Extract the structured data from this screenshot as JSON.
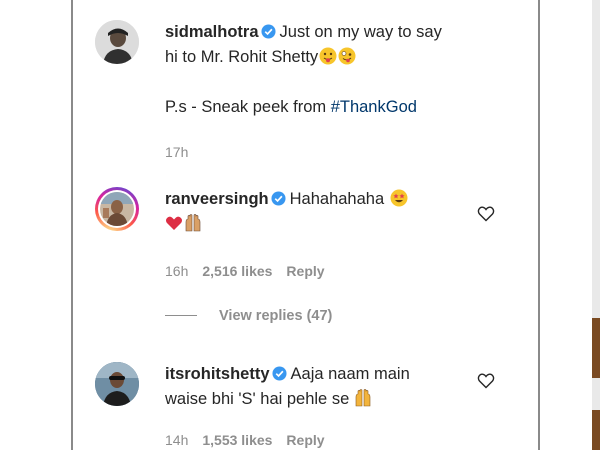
{
  "comments": [
    {
      "username": "sidmalhotra",
      "text_line1": "Just on my way to say",
      "text_line2": "hi to Mr. Rohit Shetty",
      "ps_prefix": "P.s - Sneak peek from ",
      "hashtag": "#ThankGod",
      "time": "17h",
      "avatar": "sidmalhotra-avatar"
    },
    {
      "username": "ranveersingh",
      "text": "Hahahahaha",
      "time": "16h",
      "likes": "2,516 likes",
      "reply_label": "Reply",
      "avatar": "ranveersingh-avatar"
    },
    {
      "username": "itsrohitshetty",
      "text_line1": "Aaja naam main",
      "text_line2": "waise bhi 'S' hai pehle se",
      "time": "14h",
      "likes": "1,553 likes",
      "reply_label": "Reply",
      "avatar": "itsrohitshetty-avatar"
    }
  ],
  "view_replies": "View replies (47)",
  "colors": {
    "text": "#262626",
    "muted": "#8e8e8e",
    "hashtag": "#00376b",
    "verified": "#3897f0",
    "story_ring": "#d6249f"
  },
  "icons": [
    "verified-badge-icon",
    "heart-outline-icon",
    "emoji"
  ]
}
